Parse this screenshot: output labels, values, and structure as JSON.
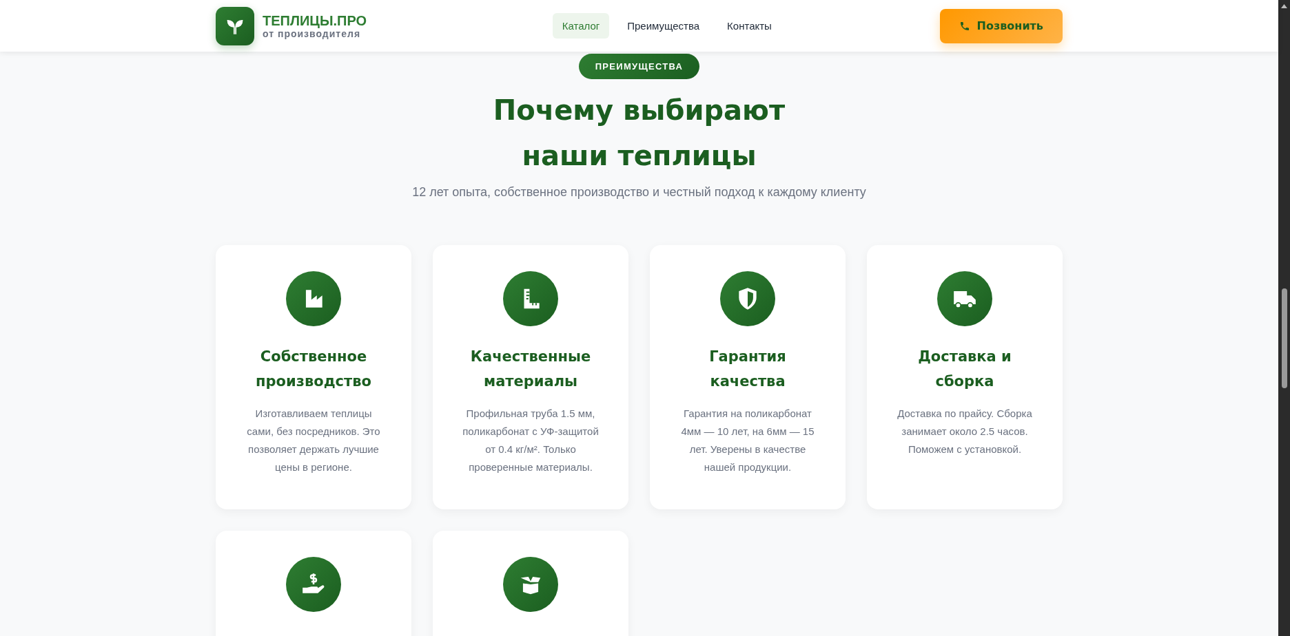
{
  "header": {
    "logo_title": "ТЕПЛИЦЫ.ПРО",
    "logo_subtitle": "от производителя",
    "nav": [
      {
        "label": "Каталог",
        "selected": true
      },
      {
        "label": "Преимущества",
        "selected": false
      },
      {
        "label": "Контакты",
        "selected": false
      }
    ],
    "call_button": "Позвонить"
  },
  "section": {
    "badge": "ПРЕИМУЩЕСТВА",
    "title": "Почему выбирают наши теплицы",
    "subtitle": "12 лет опыта, собственное производство и честный подход к каждому клиенту",
    "features": [
      {
        "kind": "full",
        "title": "Собственное производство",
        "description": "Изготавливаем теплицы сами, без посредников. Это позволяет держать лучшие цены в регионе."
      },
      {
        "kind": "full",
        "title": "Качественные материалы",
        "description": "Профильная труба 1.5 мм, поликарбонат с УФ-защитой от 0.4 кг/м². Только проверенные материалы."
      },
      {
        "kind": "full",
        "title": "Гарантия качества",
        "description": "Гарантия на поликарбонат 4мм — 10 лет, на 6мм — 15 лет. Уверены в качестве нашей продукции."
      },
      {
        "kind": "full",
        "title": "Доставка и сборка",
        "description": "Доставка по прайсу. Сборка занимает около 2.5 часов. Поможем с установкой."
      },
      {
        "kind": "cut"
      },
      {
        "kind": "cut"
      }
    ]
  }
}
